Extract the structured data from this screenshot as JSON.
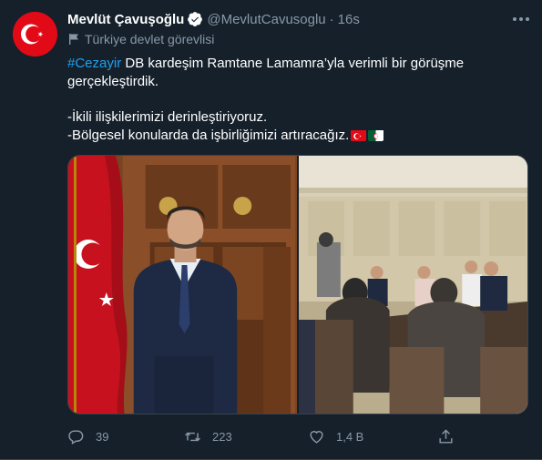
{
  "tweet": {
    "author_name": "Mevlüt Çavuşoğlu",
    "author_handle": "@MevlutCavusoglu",
    "separator": "·",
    "time": "16s",
    "account_label": "Türkiye devlet görevlisi",
    "hashtag": "#Cezayir",
    "line1_rest": " DB kardeşim Ramtane Lamamra’yla verimli bir görüşme",
    "line2": "gerçekleştirdik.",
    "line3": "-İkili ilişkilerimizi derinleştiriyoruz.",
    "line4": "-Bölgesel konularda da işbirliğimizi artıracağız."
  },
  "actions": {
    "replies": "39",
    "retweets": "223",
    "likes": "1,4 B"
  },
  "colors": {
    "background": "#15202b",
    "accent": "#1da1f2",
    "muted": "#8899a6",
    "border": "#38444d",
    "turkish_red": "#e30a17",
    "algeria_green": "#006233"
  },
  "icons": {
    "avatar": "turkish-flag-avatar",
    "verified": "verified-badge-icon",
    "more": "more-options-icon",
    "label": "government-flag-icon",
    "reply": "reply-icon",
    "retweet": "retweet-icon",
    "like": "heart-icon",
    "share": "share-icon",
    "flag1": "turkey-flag-emoji",
    "flag2": "algeria-flag-emoji"
  }
}
